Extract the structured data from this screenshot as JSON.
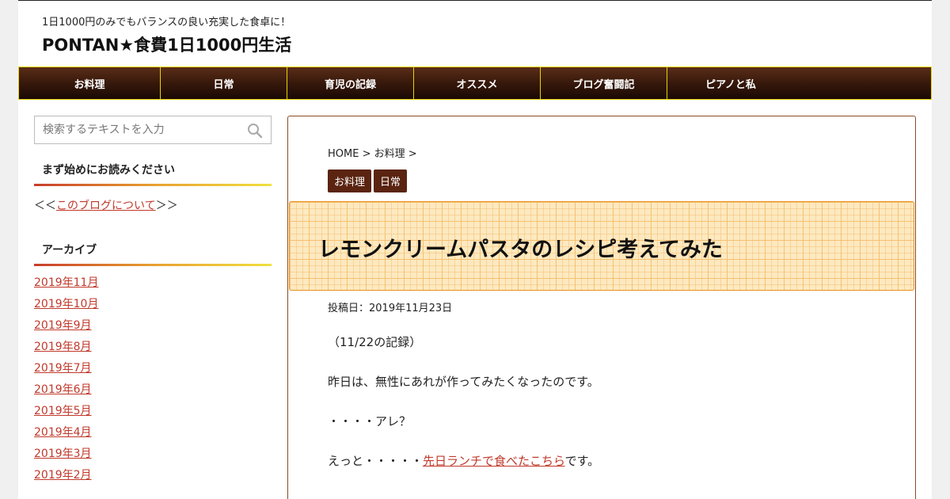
{
  "header": {
    "tagline": "1日1000円のみでもバランスの良い充実した食卓に！",
    "site_title": "PONTAN★食費1日1000円生活"
  },
  "nav": {
    "items": [
      {
        "label": "お料理"
      },
      {
        "label": "日常"
      },
      {
        "label": "育児の記録"
      },
      {
        "label": "オススメ"
      },
      {
        "label": "ブログ奮闘記"
      },
      {
        "label": "ピアノと私"
      }
    ]
  },
  "sidebar": {
    "search_placeholder": "検索するテキストを入力",
    "intro_widget": {
      "title": "まず始めにお読みください",
      "prefix": "＜＜",
      "link": "このブログについて",
      "suffix": "＞＞"
    },
    "archive_widget": {
      "title": "アーカイブ",
      "items": [
        "2019年11月",
        "2019年10月",
        "2019年9月",
        "2019年8月",
        "2019年7月",
        "2019年6月",
        "2019年5月",
        "2019年4月",
        "2019年3月",
        "2019年2月"
      ]
    }
  },
  "main": {
    "breadcrumb": "HOME > お料理 >",
    "categories": [
      "お料理",
      "日常"
    ],
    "title": "レモンクリームパスタのレシピ考えてみた",
    "date": "投稿日：2019年11月23日",
    "paragraphs": {
      "p1": "（11/22の記録）",
      "p2": "昨日は、無性にあれが作ってみたくなったのです。",
      "p3": "・・・・アレ？",
      "p4_prefix": "えっと・・・・・",
      "p4_link": "先日ランチで食べたこちら",
      "p4_suffix": "です。"
    }
  },
  "colors": {
    "nav_bg": "#3a1a0c",
    "nav_border": "#e8d400",
    "link": "#c0392b",
    "category_bg": "#5a2410",
    "title_box_bg": "#fde9c0",
    "title_box_border": "#e89020"
  },
  "icons": {
    "search": "search-icon"
  }
}
